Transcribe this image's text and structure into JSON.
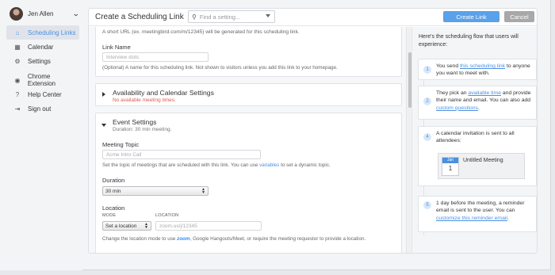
{
  "user": {
    "name": "Jen Allen"
  },
  "sidebar": {
    "items": [
      {
        "label": "Scheduling Links",
        "icon": "home-icon",
        "active": true
      },
      {
        "label": "Calendar",
        "icon": "calendar-icon",
        "active": false
      },
      {
        "label": "Settings",
        "icon": "gear-icon",
        "active": false
      },
      {
        "label": "Chrome Extension",
        "icon": "chrome-icon",
        "active": false
      },
      {
        "label": "Help Center",
        "icon": "help-icon",
        "active": false
      },
      {
        "label": "Sign out",
        "icon": "sign-out-icon",
        "active": false
      }
    ]
  },
  "header": {
    "title": "Create a Scheduling Link",
    "search_placeholder": "Find a setting...",
    "create_label": "Create Link",
    "cancel_label": "Cancel"
  },
  "link_card": {
    "hint": "A short URL (ex. meetingbird.com/m/12345) will be generated for this scheduling link.",
    "name_label": "Link Name",
    "name_placeholder": "Interview slots",
    "name_help": "(Optional) A name for this scheduling link. Not shown to visitors unless you add this link to your homepage."
  },
  "availability": {
    "title": "Availability and Calendar Settings",
    "subtitle": "No available meeting times."
  },
  "event": {
    "title": "Event Settings",
    "subtitle": "Duration: 30 min meeting.",
    "topic_label": "Meeting Topic",
    "topic_placeholder": "Acme Intro Call",
    "topic_help_pre": "Set the topic of meetings that are scheduled with this link. You can use",
    "topic_help_link": "variables",
    "topic_help_post": "to set a dynamic topic.",
    "duration_label": "Duration",
    "duration_value": "30 min",
    "location_label": "Location",
    "mode_label": "MODE",
    "location_sub_label": "LOCATION",
    "mode_value": "Set a location",
    "location_placeholder": "zoom.us/j/12345",
    "location_help_pre": "Change the location mode to use",
    "location_help_brand": "zoom",
    "location_help_post": ", Google Hangouts/Meet, or require the meeting requestor to provide a location."
  },
  "flow": {
    "heading": "Here's the scheduling flow that users will experience:",
    "step1": {
      "num": "1",
      "pre": "You send ",
      "link": "this scheduling link",
      "post": " to anyone you want to meet with."
    },
    "step2": {
      "num": "2",
      "pre": "They pick an ",
      "link1": "available time",
      "mid": " and provide their name and email. You can also add ",
      "link2": "custom questions",
      "post": "."
    },
    "step4": {
      "num": "4",
      "text": "A calendar invitation is sent to all attendees:",
      "cal_month": "Jan",
      "cal_day": "1",
      "meeting_title": "Untitled Meeting"
    },
    "step5": {
      "num": "5",
      "pre": "1 day before the meeting, a reminder email is sent to the user. You can ",
      "link": "customize this reminder email",
      "post": "."
    }
  },
  "colors": {
    "accent": "#4a90e2",
    "create_button": "#5aa0ea",
    "error": "#e05a4f"
  }
}
